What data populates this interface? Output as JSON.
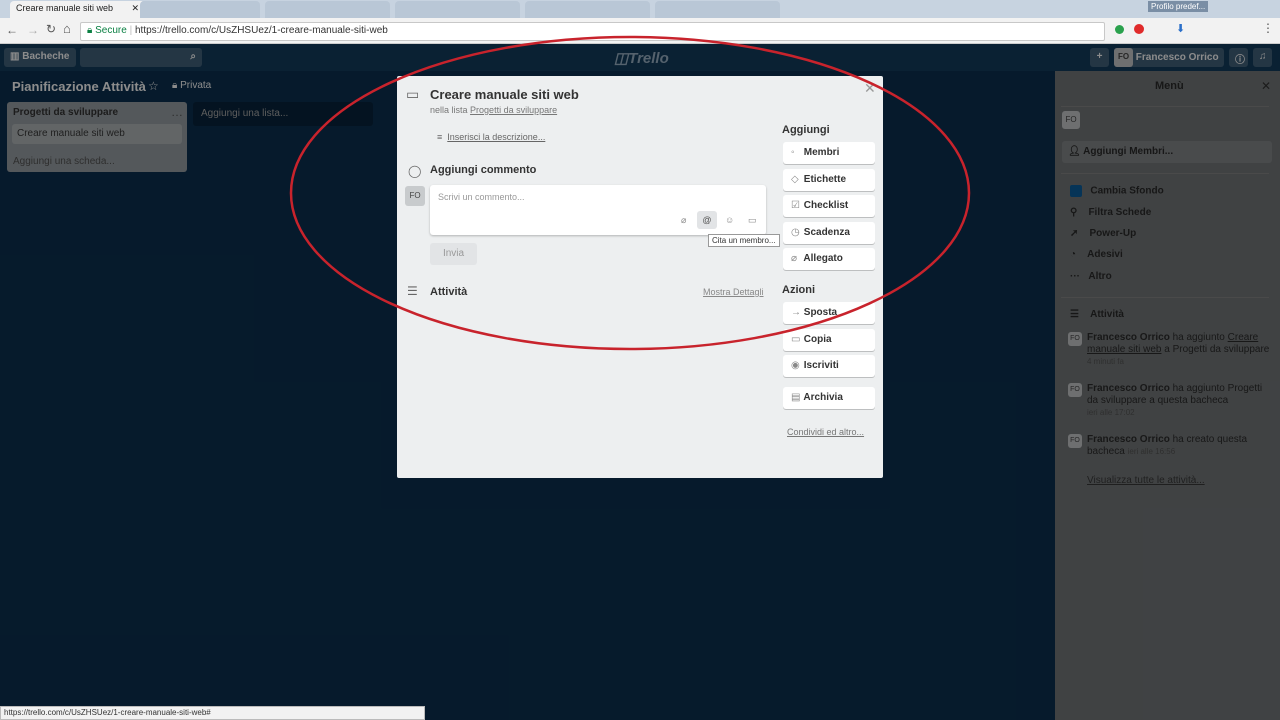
{
  "browser": {
    "tabs": [
      {
        "label": "Creare manuale siti web",
        "active": true
      }
    ],
    "url_secure": "Secure",
    "url": "https://trello.com/c/UsZHSUez/1-creare-manuale-siti-web",
    "profile": "Profilo predef...",
    "status_url": "https://trello.com/c/UsZHSUez/1-creare-manuale-siti-web#"
  },
  "header": {
    "boards": "Bacheche",
    "logo": "Trello",
    "user_initials": "FO",
    "user_name": "Francesco Orrico"
  },
  "board": {
    "title": "Pianificazione Attività",
    "visibility": "Privata",
    "list_title": "Progetti da sviluppare",
    "card": "Creare manuale siti web",
    "add_card": "Aggiungi una scheda...",
    "add_list": "Aggiungi una lista..."
  },
  "modal": {
    "title": "Creare manuale siti web",
    "in_list_prefix": "nella lista",
    "in_list_name": "Progetti da sviluppare",
    "description_link": "Inserisci la descrizione...",
    "comment_heading": "Aggiungi commento",
    "avatar": "FO",
    "comment_placeholder": "Scrivi un commento...",
    "tooltip": "Cita un membro...",
    "send": "Invia",
    "activity": "Attività",
    "details": "Mostra Dettagli",
    "add_heading": "Aggiungi",
    "add_buttons": [
      "Membri",
      "Etichette",
      "Checklist",
      "Scadenza",
      "Allegato"
    ],
    "actions_heading": "Azioni",
    "action_buttons": [
      "Sposta",
      "Copia",
      "Iscriviti",
      "Archivia"
    ],
    "share": "Condividi ed altro..."
  },
  "menu": {
    "title": "Menù",
    "avatar": "FO",
    "add_members": "Aggiungi Membri...",
    "items": [
      "Cambia Sfondo",
      "Filtra Schede",
      "Power-Up",
      "Adesivi",
      "Altro"
    ],
    "activity_heading": "Attività",
    "activities": [
      {
        "who": "Francesco Orrico",
        "text": "ha aggiunto",
        "link": "Creare manuale siti web",
        "tail": "a Progetti da sviluppare",
        "time": "4 minuti fa"
      },
      {
        "who": "Francesco Orrico",
        "text": "ha aggiunto Progetti da sviluppare a questa bacheca",
        "time": "ieri alle 17:02"
      },
      {
        "who": "Francesco Orrico",
        "text": "ha creato questa bacheca",
        "time": "ieri alle 16:56"
      }
    ],
    "show_all": "Visualizza tutte le attività..."
  },
  "colors": {
    "annotation": "#c8232c",
    "board_bg": "#0b3150",
    "accent": "#0079bf"
  }
}
